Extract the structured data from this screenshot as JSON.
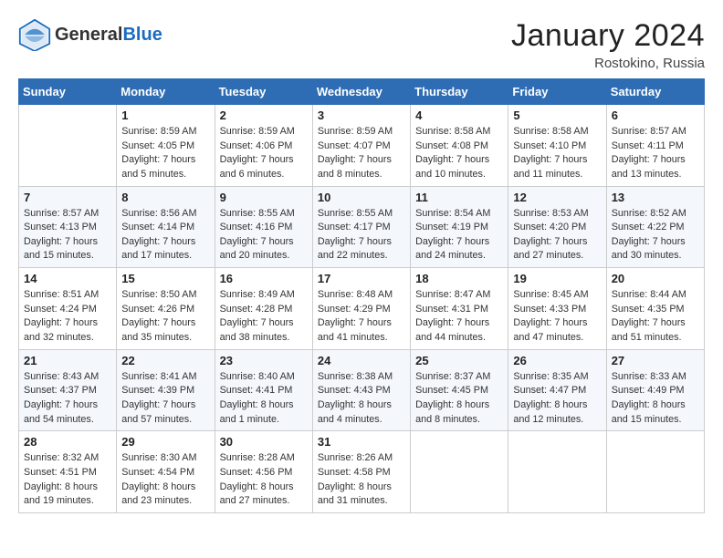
{
  "header": {
    "logo_general": "General",
    "logo_blue": "Blue",
    "month_title": "January 2024",
    "location": "Rostokino, Russia"
  },
  "days_of_week": [
    "Sunday",
    "Monday",
    "Tuesday",
    "Wednesday",
    "Thursday",
    "Friday",
    "Saturday"
  ],
  "weeks": [
    [
      {
        "day": "",
        "info": ""
      },
      {
        "day": "1",
        "info": "Sunrise: 8:59 AM\nSunset: 4:05 PM\nDaylight: 7 hours\nand 5 minutes."
      },
      {
        "day": "2",
        "info": "Sunrise: 8:59 AM\nSunset: 4:06 PM\nDaylight: 7 hours\nand 6 minutes."
      },
      {
        "day": "3",
        "info": "Sunrise: 8:59 AM\nSunset: 4:07 PM\nDaylight: 7 hours\nand 8 minutes."
      },
      {
        "day": "4",
        "info": "Sunrise: 8:58 AM\nSunset: 4:08 PM\nDaylight: 7 hours\nand 10 minutes."
      },
      {
        "day": "5",
        "info": "Sunrise: 8:58 AM\nSunset: 4:10 PM\nDaylight: 7 hours\nand 11 minutes."
      },
      {
        "day": "6",
        "info": "Sunrise: 8:57 AM\nSunset: 4:11 PM\nDaylight: 7 hours\nand 13 minutes."
      }
    ],
    [
      {
        "day": "7",
        "info": "Sunrise: 8:57 AM\nSunset: 4:13 PM\nDaylight: 7 hours\nand 15 minutes."
      },
      {
        "day": "8",
        "info": "Sunrise: 8:56 AM\nSunset: 4:14 PM\nDaylight: 7 hours\nand 17 minutes."
      },
      {
        "day": "9",
        "info": "Sunrise: 8:55 AM\nSunset: 4:16 PM\nDaylight: 7 hours\nand 20 minutes."
      },
      {
        "day": "10",
        "info": "Sunrise: 8:55 AM\nSunset: 4:17 PM\nDaylight: 7 hours\nand 22 minutes."
      },
      {
        "day": "11",
        "info": "Sunrise: 8:54 AM\nSunset: 4:19 PM\nDaylight: 7 hours\nand 24 minutes."
      },
      {
        "day": "12",
        "info": "Sunrise: 8:53 AM\nSunset: 4:20 PM\nDaylight: 7 hours\nand 27 minutes."
      },
      {
        "day": "13",
        "info": "Sunrise: 8:52 AM\nSunset: 4:22 PM\nDaylight: 7 hours\nand 30 minutes."
      }
    ],
    [
      {
        "day": "14",
        "info": "Sunrise: 8:51 AM\nSunset: 4:24 PM\nDaylight: 7 hours\nand 32 minutes."
      },
      {
        "day": "15",
        "info": "Sunrise: 8:50 AM\nSunset: 4:26 PM\nDaylight: 7 hours\nand 35 minutes."
      },
      {
        "day": "16",
        "info": "Sunrise: 8:49 AM\nSunset: 4:28 PM\nDaylight: 7 hours\nand 38 minutes."
      },
      {
        "day": "17",
        "info": "Sunrise: 8:48 AM\nSunset: 4:29 PM\nDaylight: 7 hours\nand 41 minutes."
      },
      {
        "day": "18",
        "info": "Sunrise: 8:47 AM\nSunset: 4:31 PM\nDaylight: 7 hours\nand 44 minutes."
      },
      {
        "day": "19",
        "info": "Sunrise: 8:45 AM\nSunset: 4:33 PM\nDaylight: 7 hours\nand 47 minutes."
      },
      {
        "day": "20",
        "info": "Sunrise: 8:44 AM\nSunset: 4:35 PM\nDaylight: 7 hours\nand 51 minutes."
      }
    ],
    [
      {
        "day": "21",
        "info": "Sunrise: 8:43 AM\nSunset: 4:37 PM\nDaylight: 7 hours\nand 54 minutes."
      },
      {
        "day": "22",
        "info": "Sunrise: 8:41 AM\nSunset: 4:39 PM\nDaylight: 7 hours\nand 57 minutes."
      },
      {
        "day": "23",
        "info": "Sunrise: 8:40 AM\nSunset: 4:41 PM\nDaylight: 8 hours\nand 1 minute."
      },
      {
        "day": "24",
        "info": "Sunrise: 8:38 AM\nSunset: 4:43 PM\nDaylight: 8 hours\nand 4 minutes."
      },
      {
        "day": "25",
        "info": "Sunrise: 8:37 AM\nSunset: 4:45 PM\nDaylight: 8 hours\nand 8 minutes."
      },
      {
        "day": "26",
        "info": "Sunrise: 8:35 AM\nSunset: 4:47 PM\nDaylight: 8 hours\nand 12 minutes."
      },
      {
        "day": "27",
        "info": "Sunrise: 8:33 AM\nSunset: 4:49 PM\nDaylight: 8 hours\nand 15 minutes."
      }
    ],
    [
      {
        "day": "28",
        "info": "Sunrise: 8:32 AM\nSunset: 4:51 PM\nDaylight: 8 hours\nand 19 minutes."
      },
      {
        "day": "29",
        "info": "Sunrise: 8:30 AM\nSunset: 4:54 PM\nDaylight: 8 hours\nand 23 minutes."
      },
      {
        "day": "30",
        "info": "Sunrise: 8:28 AM\nSunset: 4:56 PM\nDaylight: 8 hours\nand 27 minutes."
      },
      {
        "day": "31",
        "info": "Sunrise: 8:26 AM\nSunset: 4:58 PM\nDaylight: 8 hours\nand 31 minutes."
      },
      {
        "day": "",
        "info": ""
      },
      {
        "day": "",
        "info": ""
      },
      {
        "day": "",
        "info": ""
      }
    ]
  ]
}
